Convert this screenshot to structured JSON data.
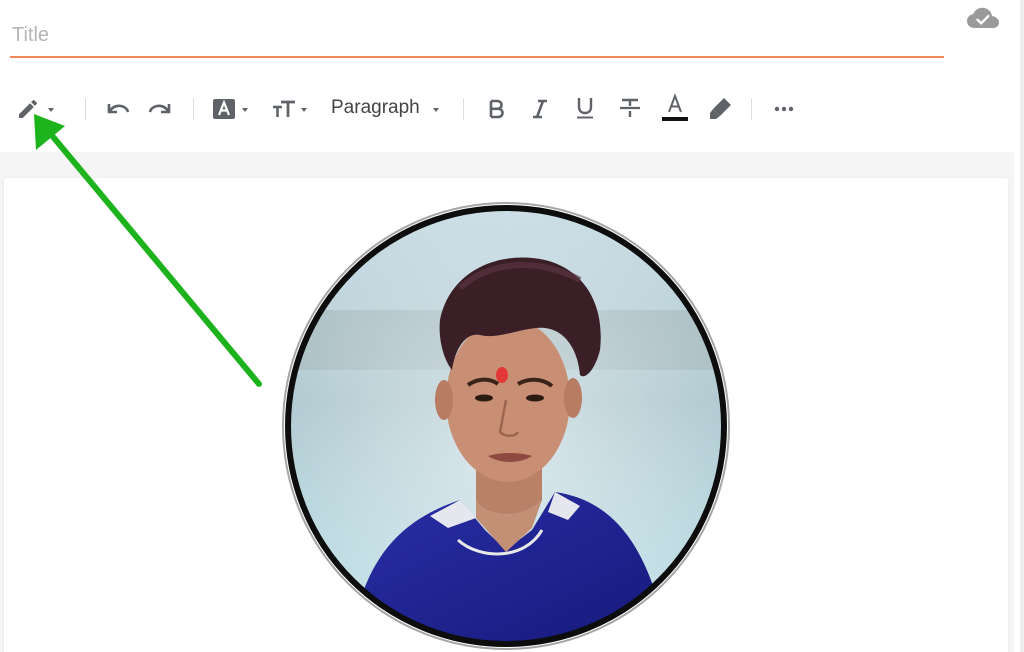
{
  "title_field": {
    "placeholder": "Title",
    "value": "",
    "underline_color": "#f08a5d"
  },
  "status": {
    "icon": "cloud-check-icon"
  },
  "toolbar": {
    "items": [
      {
        "name": "compose-mode-button",
        "icon": "pencil-icon",
        "has_dropdown": true
      },
      {
        "name": "undo-button",
        "icon": "undo-icon"
      },
      {
        "name": "redo-button",
        "icon": "redo-icon"
      },
      {
        "name": "font-style-button",
        "icon": "font-box-icon",
        "has_dropdown": true
      },
      {
        "name": "font-size-button",
        "icon": "text-size-icon",
        "has_dropdown": true
      },
      {
        "name": "bold-button",
        "icon": "bold-icon"
      },
      {
        "name": "italic-button",
        "icon": "italic-icon"
      },
      {
        "name": "underline-button",
        "icon": "underline-icon"
      },
      {
        "name": "strikethrough-button",
        "icon": "strikethrough-icon"
      },
      {
        "name": "text-color-button",
        "icon": "text-color-icon"
      },
      {
        "name": "highlight-button",
        "icon": "highlighter-icon"
      },
      {
        "name": "more-options-button",
        "icon": "more-horizontal-icon"
      }
    ],
    "paragraph_select": {
      "value": "Paragraph"
    },
    "icon_color": "#5f6368"
  },
  "editor": {
    "content": {
      "image": "circular-profile-photo"
    }
  },
  "annotation": {
    "arrow_color": "#1db31d",
    "points_to": "compose-mode-button"
  }
}
